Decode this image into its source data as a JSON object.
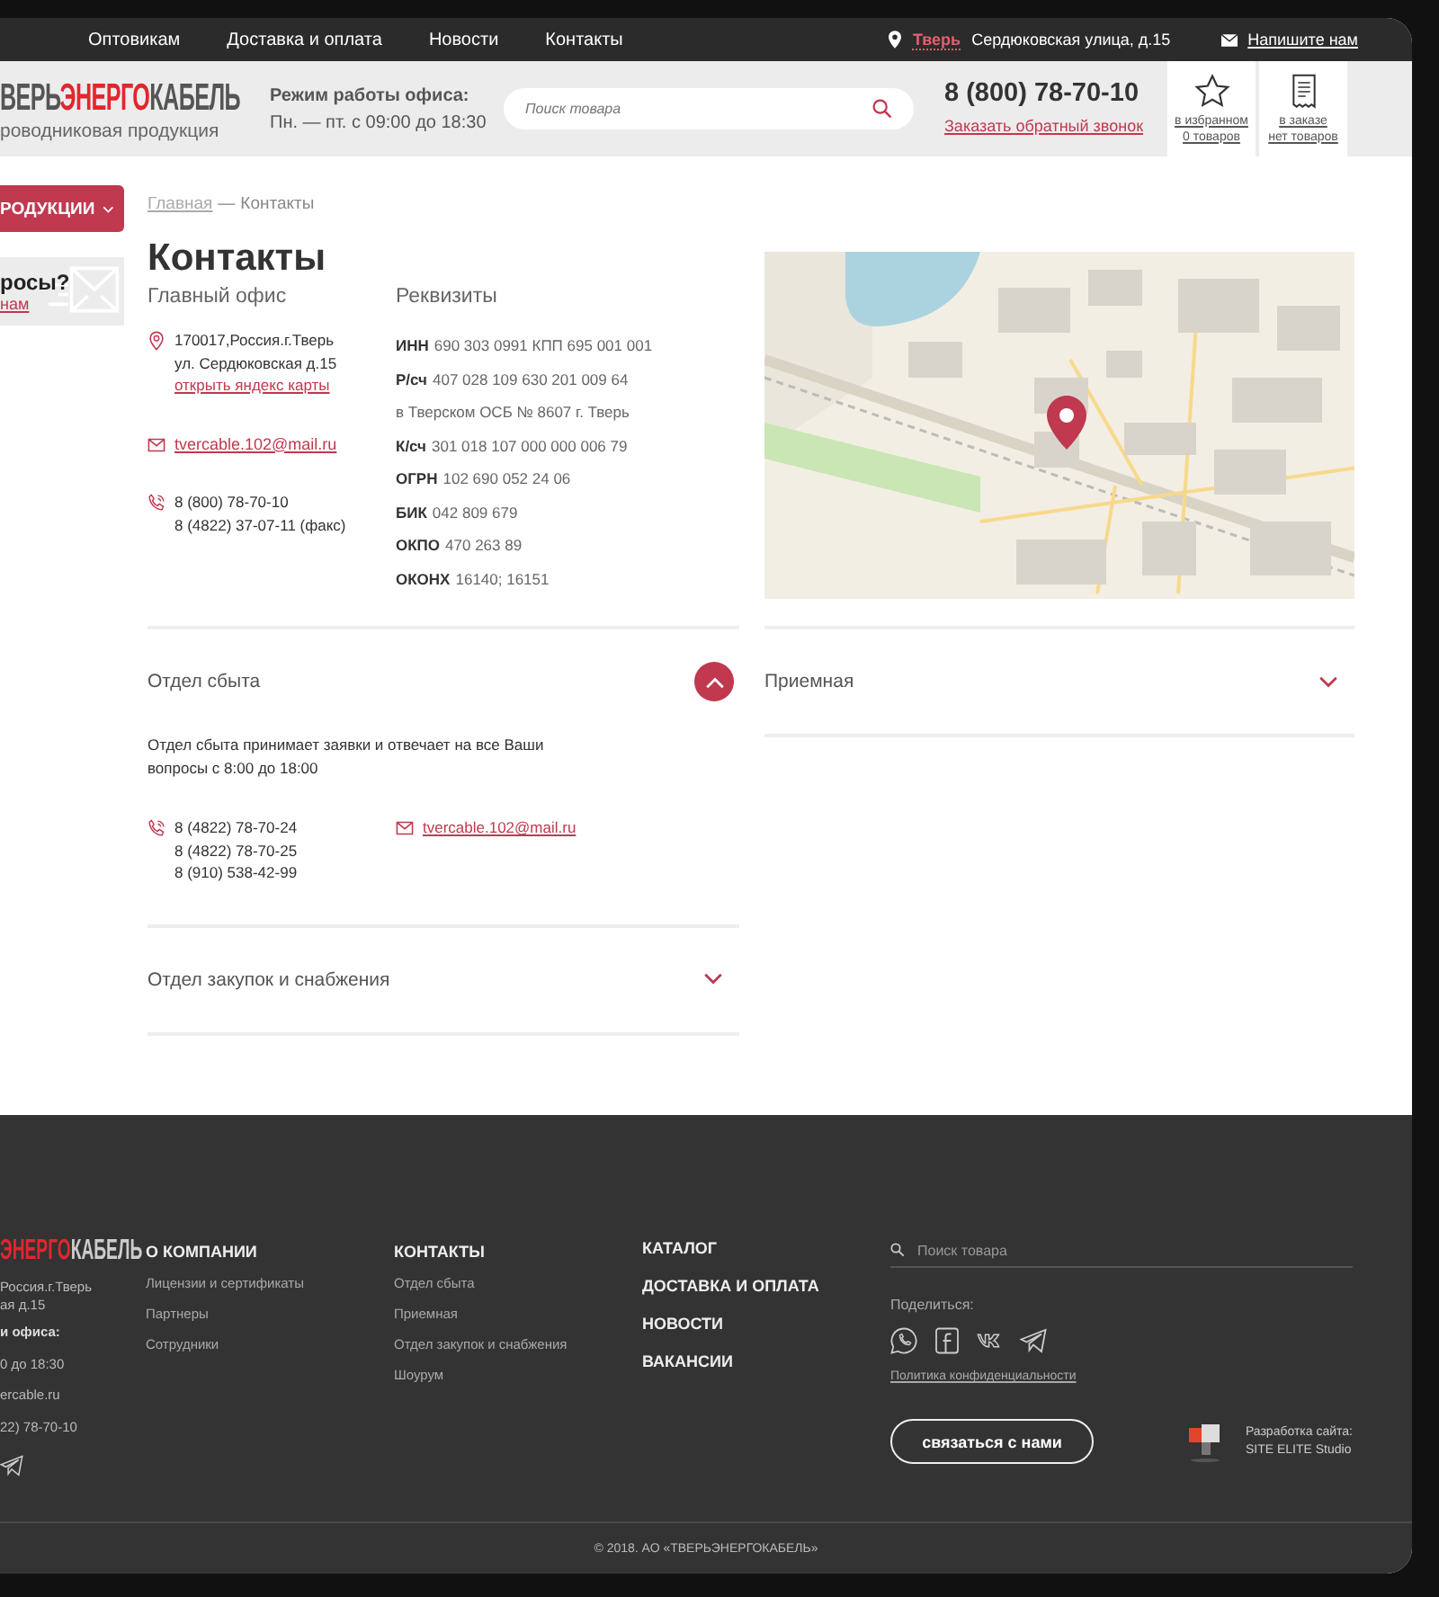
{
  "top_nav": {
    "links": [
      "Оптовикам",
      "Доставка и оплата",
      "Новости",
      "Контакты"
    ],
    "city": "Тверь",
    "address": "Сердюковская улица, д.15",
    "write_link": "Напишите нам"
  },
  "header": {
    "logo": {
      "part1": "ВЕРЬ",
      "part2": "ЭНЕРГО",
      "part3": "КАБЕЛЬ",
      "tagline": "роводниковая продукция"
    },
    "hours_title": "Режим работы офиса:",
    "hours": "Пн. — пт. с 09:00 до 18:30",
    "search": {
      "placeholder": "Поиск товара"
    },
    "phone": "8 (800) 78-70-10",
    "callback_link": "Заказать обратный звонок",
    "favorites": [
      "в избранном",
      "0 товаров"
    ],
    "order": [
      "в заказе",
      "нет товаров"
    ]
  },
  "sidebar": {
    "catalog_button": "РОДУКЦИИ",
    "question_title": "росы?",
    "question_link": "нам"
  },
  "breadcrumb": {
    "home": "Главная",
    "separator": "—",
    "current": "Контакты"
  },
  "title": "Контакты",
  "main_office": {
    "heading": "Главный офис",
    "address_lines": [
      "170017,Россия.г.Тверь",
      "ул. Сердюковская д.15"
    ],
    "map_link": "открыть яндекс карты",
    "email": "tvercable.102@mail.ru",
    "phones": [
      "8 (800) 78-70-10",
      "8 (4822) 37-07-11 (факс)"
    ]
  },
  "requisites": {
    "heading": "Реквизиты",
    "rows": [
      {
        "label": "ИНН",
        "value": "690 303 0991 КПП 695 001 001"
      },
      {
        "label": "Р/сч",
        "value": "407 028 109 630 201 009 64"
      },
      {
        "value": "в Тверском ОСБ № 8607  г. Тверь"
      },
      {
        "label": "К/сч",
        "value": "301 018 107 000 000 006 79"
      },
      {
        "label": "ОГРН",
        "value": "102 690 052 24 06"
      },
      {
        "label": "БИК",
        "value": "042 809 679"
      },
      {
        "label": "ОКПО",
        "value": "470 263 89"
      },
      {
        "label": "ОКОНХ",
        "value": "16140; 16151"
      }
    ]
  },
  "departments_left": [
    {
      "title": "Отдел сбыта",
      "expanded": true,
      "description": "Отдел сбыта принимает заявки и отвечает на все Ваши вопросы с 8:00 до 18:00",
      "phones": [
        "8 (4822) 78-70-24",
        "8 (4822) 78-70-25",
        "8 (910) 538-42-99"
      ],
      "email": "tvercable.102@mail.ru"
    },
    {
      "title": "Отдел закупок и снабжения",
      "expanded": false
    }
  ],
  "departments_right": [
    {
      "title": "Приемная",
      "expanded": false
    }
  ],
  "footer": {
    "logo": {
      "part1": "ЭНЕРГО",
      "part2": "КАБЕЛЬ"
    },
    "info_lines": [
      {
        "kind": "text",
        "text": "Россия.г.Тверь"
      },
      {
        "kind": "text",
        "text": "ая д.15"
      },
      {
        "kind": "bold",
        "text": "и офиса:"
      },
      {
        "kind": "text",
        "text": "0 до 18:30"
      },
      {
        "kind": "text",
        "text": "ercable.ru"
      },
      {
        "kind": "text",
        "text": "22) 78-70-10"
      }
    ],
    "company": {
      "heading": "О КОМПАНИИ",
      "links": [
        "Лицензии и сертификаты",
        "Партнеры",
        "Сотрудники"
      ]
    },
    "contacts": {
      "heading": "КОНТАКТЫ",
      "links": [
        "Отдел сбыта",
        "Приемная",
        "Отдел закупок и снабжения",
        "Шоурум"
      ]
    },
    "main_links": [
      "КАТАЛОГ",
      "ДОСТАВКА И ОПЛАТА",
      "НОВОСТИ",
      "ВАКАНСИИ"
    ],
    "search": {
      "placeholder": "Поиск товара"
    },
    "share_label": "Поделиться:",
    "privacy_link": "Политика конфиденциальности",
    "contact_button": "связаться с нами",
    "developer": [
      "Разработка сайта:",
      "SITE ELITE Studio"
    ],
    "copyright": "© 2018. АО «ТВЕРЬЭНЕРГОКАБЕЛЬ»"
  }
}
